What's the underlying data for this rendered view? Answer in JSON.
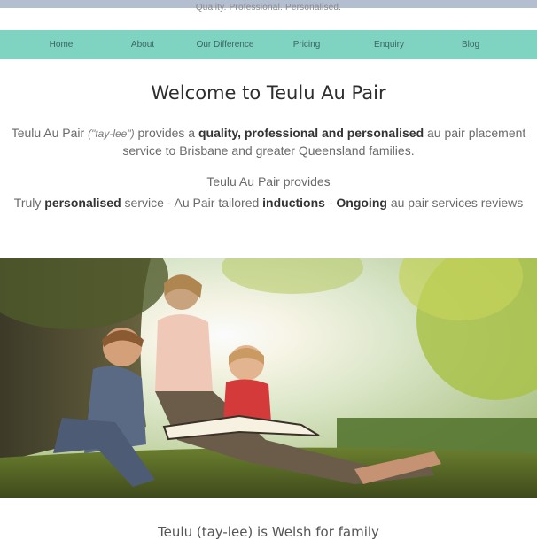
{
  "header": {
    "tagline": "Quality. Professional. Personalised."
  },
  "nav": {
    "items": [
      {
        "label": "Home"
      },
      {
        "label": "About"
      },
      {
        "label": "Our Difference"
      },
      {
        "label": "Pricing"
      },
      {
        "label": "Enquiry"
      },
      {
        "label": "Blog"
      }
    ]
  },
  "main": {
    "title": "Welcome to Teulu Au Pair",
    "intro": {
      "lead": "Teulu Au Pair ",
      "pronunciation": "(\"tay-lee\")",
      "mid": " provides a ",
      "bold1": "quality,",
      "space": " ",
      "bold2": "professional and personalised",
      "tail": "  au pair placement service to Brisbane and greater Queensland families."
    },
    "provides_heading": "Teulu Au Pair provides",
    "points": {
      "p1_pre": "Truly ",
      "p1_bold": "personalised",
      "p1_post": " service",
      "sep1": "  -  ",
      "p2_pre": "Au Pair tailored ",
      "p2_bold": "inductions",
      "sep2": "  -  ",
      "p3_bold": "Ongoing",
      "p3_post": " au pair services reviews"
    },
    "hero_image": {
      "description_icon": "family-reading-photo"
    },
    "footer_text": "Teulu (tay-lee) is Welsh for family"
  },
  "colors": {
    "nav_background": "#7fd3c1",
    "nav_text": "#3b6661",
    "top_strip": "#b3bfd0"
  }
}
